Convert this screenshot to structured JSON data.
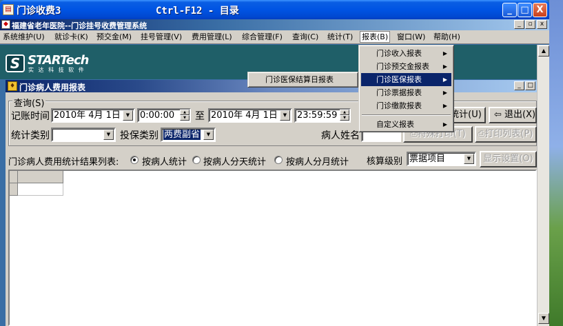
{
  "outer_window": {
    "title": "门诊收费3",
    "shortcut": "Ctrl-F12 - 目录",
    "buttons": {
      "minimize": "_",
      "maximize": "□",
      "close": "X"
    }
  },
  "mdi_frame": {
    "title": "福建省老年医院--门诊挂号收费管理系统"
  },
  "menubar": [
    "系统维护(U)",
    "就诊卡(K)",
    "预交金(M)",
    "挂号管理(V)",
    "费用管理(L)",
    "综合管理(F)",
    "查询(C)",
    "统计(T)",
    "报表(B)",
    "窗口(W)",
    "帮助(H)"
  ],
  "logo": {
    "brand": "STARTech",
    "subtitle": "实 达 科 技 软 件",
    "mark": "S"
  },
  "report_menu": {
    "items": [
      "门诊收入报表",
      "门诊预交金报表",
      "门诊医保报表",
      "门诊票据报表",
      "门诊缴款报表",
      "自定义报表"
    ],
    "active_index": 2
  },
  "submenu": {
    "items": [
      "门诊医保结算日报表"
    ]
  },
  "child_window": {
    "title": "门诊病人费用报表"
  },
  "query": {
    "group_label": "查询(S)",
    "date_label": "记账时间",
    "from_date": "2010年 4月 1日",
    "from_time": "0:00:00",
    "to_label": "至",
    "to_date": "2010年 4月 1日",
    "to_time": "23:59:59",
    "stat_type_label": "统计类别",
    "stat_type_value": "",
    "insure_type_label": "投保类别",
    "insure_type_value": "两费副省",
    "patient_name_label": "病人姓名",
    "patient_name_value": "",
    "stat_button": "统计(U)",
    "exit_button": "退出(X)",
    "special_print_button": "特殊打印(T)",
    "print_list_button": "打印列表(P)"
  },
  "results": {
    "label": "门诊病人费用统计结果列表:",
    "options": [
      "按病人统计",
      "按病人分天统计",
      "按病人分月统计"
    ],
    "selected_index": 0,
    "level_label": "核算级别",
    "level_value": "票据项目",
    "display_settings_button": "显示设置(O)"
  },
  "colors": {
    "xp_title": "#0054e3",
    "banner": "#1f5f68",
    "menu_highlight": "#0a246a",
    "face": "#d4d0c8"
  }
}
